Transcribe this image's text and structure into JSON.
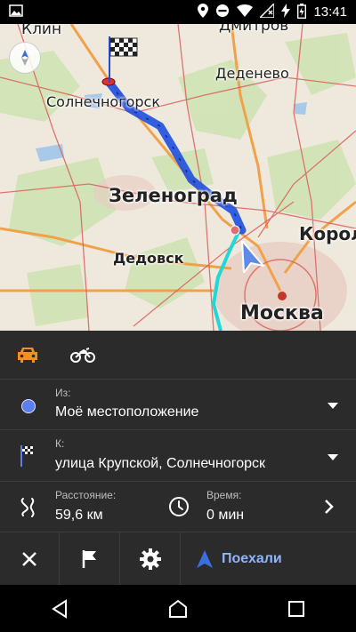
{
  "status_bar": {
    "time": "13:41",
    "icons": [
      "image-icon",
      "location-icon",
      "block-icon",
      "wifi-icon",
      "signal-icon",
      "no-sim-icon",
      "battery-charging-icon"
    ]
  },
  "map": {
    "labels": {
      "klin": "Клин",
      "dmitrov": "Дмитров",
      "dedenevo": "Деденево",
      "solnechnogorsk": "Солнечногорск",
      "zelenograd": "Зеленоград",
      "korolev": "Корол",
      "dedovsk": "Дедовск",
      "moskva": "Москва"
    },
    "colors": {
      "route": "#1f4fe0",
      "alt_route": "#20d8d8",
      "position_arrow": "#5f8ae8"
    }
  },
  "panel": {
    "from": {
      "caption": "Из:",
      "value": "Моё местоположение"
    },
    "to": {
      "caption": "К:",
      "value": "улица Крупской, Солнечногорск"
    },
    "distance": {
      "caption": "Расстояние:",
      "value": "59,6 км"
    },
    "time": {
      "caption": "Время:",
      "value": "0 мин"
    },
    "go_label": "Поехали",
    "accent_color": "#f0902a"
  }
}
